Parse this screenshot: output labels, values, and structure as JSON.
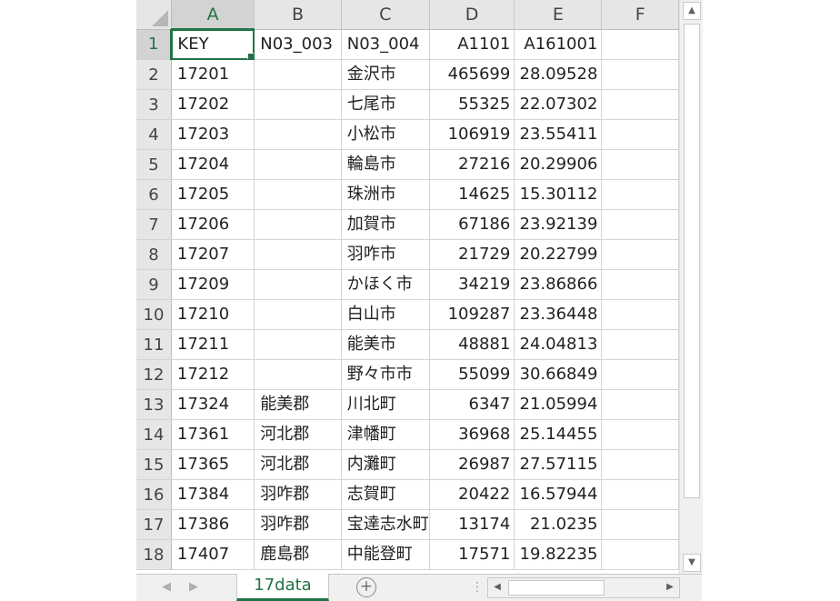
{
  "window": {
    "title": ""
  },
  "columns": [
    "A",
    "B",
    "C",
    "D",
    "E",
    "F"
  ],
  "rows": [
    {
      "n": "1",
      "a": "KEY",
      "b": "N03_003",
      "c": "N03_004",
      "d": "A1101",
      "e": "A161001"
    },
    {
      "n": "2",
      "a": "17201",
      "b": "",
      "c": "金沢市",
      "d": "465699",
      "e": "28.09528"
    },
    {
      "n": "3",
      "a": "17202",
      "b": "",
      "c": "七尾市",
      "d": "55325",
      "e": "22.07302"
    },
    {
      "n": "4",
      "a": "17203",
      "b": "",
      "c": "小松市",
      "d": "106919",
      "e": "23.55411"
    },
    {
      "n": "5",
      "a": "17204",
      "b": "",
      "c": "輪島市",
      "d": "27216",
      "e": "20.29906"
    },
    {
      "n": "6",
      "a": "17205",
      "b": "",
      "c": "珠洲市",
      "d": "14625",
      "e": "15.30112"
    },
    {
      "n": "7",
      "a": "17206",
      "b": "",
      "c": "加賀市",
      "d": "67186",
      "e": "23.92139"
    },
    {
      "n": "8",
      "a": "17207",
      "b": "",
      "c": "羽咋市",
      "d": "21729",
      "e": "20.22799"
    },
    {
      "n": "9",
      "a": "17209",
      "b": "",
      "c": "かほく市",
      "d": "34219",
      "e": "23.86866"
    },
    {
      "n": "10",
      "a": "17210",
      "b": "",
      "c": "白山市",
      "d": "109287",
      "e": "23.36448"
    },
    {
      "n": "11",
      "a": "17211",
      "b": "",
      "c": "能美市",
      "d": "48881",
      "e": "24.04813"
    },
    {
      "n": "12",
      "a": "17212",
      "b": "",
      "c": "野々市市",
      "d": "55099",
      "e": "30.66849"
    },
    {
      "n": "13",
      "a": "17324",
      "b": "能美郡",
      "c": "川北町",
      "d": "6347",
      "e": "21.05994"
    },
    {
      "n": "14",
      "a": "17361",
      "b": "河北郡",
      "c": "津幡町",
      "d": "36968",
      "e": "25.14455"
    },
    {
      "n": "15",
      "a": "17365",
      "b": "河北郡",
      "c": "内灘町",
      "d": "26987",
      "e": "27.57115"
    },
    {
      "n": "16",
      "a": "17384",
      "b": "羽咋郡",
      "c": "志賀町",
      "d": "20422",
      "e": "16.57944"
    },
    {
      "n": "17",
      "a": "17386",
      "b": "羽咋郡",
      "c": "宝達志水町",
      "d": "13174",
      "e": "21.0235"
    },
    {
      "n": "18",
      "a": "17407",
      "b": "鹿島郡",
      "c": "中能登町",
      "d": "17571",
      "e": "19.82235"
    }
  ],
  "selected_cell": "A1",
  "sheet_tab": {
    "label": "17data"
  },
  "icons": {
    "add_sheet": "plus-circle-icon",
    "scroll_up": "triangle-up-icon",
    "scroll_down": "triangle-down-icon",
    "scroll_left": "triangle-left-icon",
    "scroll_right": "triangle-right-icon",
    "tab_prev": "chevron-left-icon",
    "tab_next": "chevron-right-icon"
  },
  "colors": {
    "accent": "#217346",
    "header_bg": "#e6e6e6",
    "gridline": "#d4d4d4"
  }
}
